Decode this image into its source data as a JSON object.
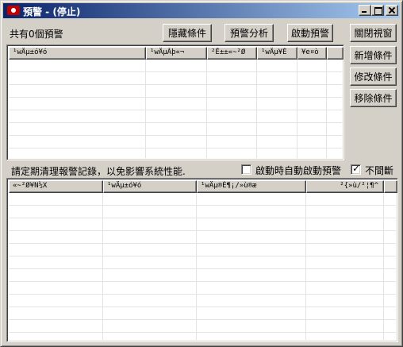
{
  "window": {
    "title": "預警 - (停止)",
    "minimize_label": "",
    "maximize_label": "",
    "close_label": ""
  },
  "top": {
    "count_text": "共有0個預警",
    "hide_conditions": "隱藏條件",
    "alert_analysis": "預警分析",
    "start_alert": "啟動預警",
    "close_window": "關閉視窗"
  },
  "side_buttons": {
    "add_condition": "新增條件",
    "edit_condition": "修改條件",
    "remove_condition": "移除條件"
  },
  "upper_list": {
    "columns": [
      "¹wÄµ±ó¥ó",
      "¹wÄµÃþ«¬",
      "²Ê±±«~²Ø",
      "¹wÄµ¥È",
      "¥e¤ò",
      ""
    ],
    "rows": [
      "",
      "",
      "",
      "",
      "",
      "",
      "",
      "",
      ""
    ]
  },
  "middle": {
    "notice": "請定期清理報警記錄，以免影響系統性能.",
    "auto_start_label": "啟動時自動啟動預警",
    "auto_start_checked": false,
    "continuous_label": "不間斷",
    "continuous_checked": true,
    "check_mark": "✓"
  },
  "lower_list": {
    "columns": [
      "«~²Ø¥N½X",
      "¹wÄµ±ó¥ó",
      "¹wÄµ®É¶¡/»ù®æ",
      "²{»ù/²¦¶^",
      ""
    ],
    "rows": [
      "",
      "",
      "",
      "",
      "",
      "",
      "",
      "",
      "",
      "",
      "",
      ""
    ]
  }
}
